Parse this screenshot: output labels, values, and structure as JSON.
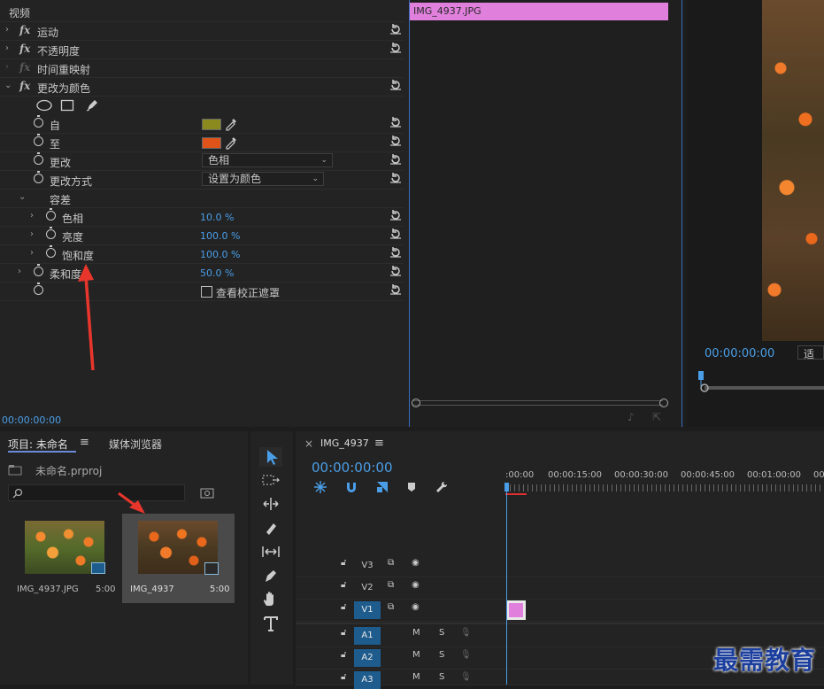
{
  "effect_controls": {
    "section_video": "视频",
    "rows": [
      {
        "label": "运动",
        "type": "fx"
      },
      {
        "label": "不透明度",
        "type": "fx"
      },
      {
        "label": "时间重映射",
        "type": "fx_dim"
      },
      {
        "label": "更改为颜色",
        "type": "fx_open"
      }
    ],
    "from_label": "自",
    "to_label": "至",
    "from_color": "#8a8a1e",
    "to_color": "#e0541a",
    "change_label": "更改",
    "change_value": "色相",
    "change_by_label": "更改方式",
    "change_by_value": "设置为颜色",
    "tolerance_label": "容差",
    "hue_label": "色相",
    "hue_value": "10.0 %",
    "lightness_label": "亮度",
    "lightness_value": "100.0 %",
    "saturation_label": "饱和度",
    "saturation_value": "100.0 %",
    "softness_label": "柔和度",
    "softness_value": "50.0 %",
    "mask_checkbox_label": "查看校正遮罩",
    "timecode": "00:00:00:00"
  },
  "fx_timeline": {
    "clip_name": "IMG_4937.JPG"
  },
  "program_monitor": {
    "timecode": "00:00:00:00",
    "fit_label": "适合"
  },
  "project": {
    "tab_project": "项目: 未命名",
    "tab_media": "媒体浏览器",
    "project_file": "未命名.prproj",
    "items": [
      {
        "name": "IMG_4937.JPG",
        "duration": "5:00"
      },
      {
        "name": "IMG_4937",
        "duration": "5:00"
      }
    ]
  },
  "timeline": {
    "sequence_name": "IMG_4937",
    "timecode": "00:00:00:00",
    "ruler": [
      ":00:00",
      "00:00:15:00",
      "00:00:30:00",
      "00:00:45:00",
      "00:01:00:00",
      "00"
    ],
    "tracks": [
      {
        "name": "V3",
        "kind": "video",
        "active": false
      },
      {
        "name": "V2",
        "kind": "video",
        "active": false
      },
      {
        "name": "V1",
        "kind": "video",
        "active": true
      },
      {
        "name": "A1",
        "kind": "audio",
        "active": true
      },
      {
        "name": "A2",
        "kind": "audio",
        "active": true
      },
      {
        "name": "A3",
        "kind": "audio",
        "active": true
      }
    ],
    "mute_label": "M",
    "solo_label": "S"
  },
  "watermark": "最需教育",
  "colors": {
    "accent": "#4a9ee8",
    "clip_pink": "#e07fdc",
    "playhead_red": "#e03030",
    "annotation_red": "#e8362c"
  }
}
